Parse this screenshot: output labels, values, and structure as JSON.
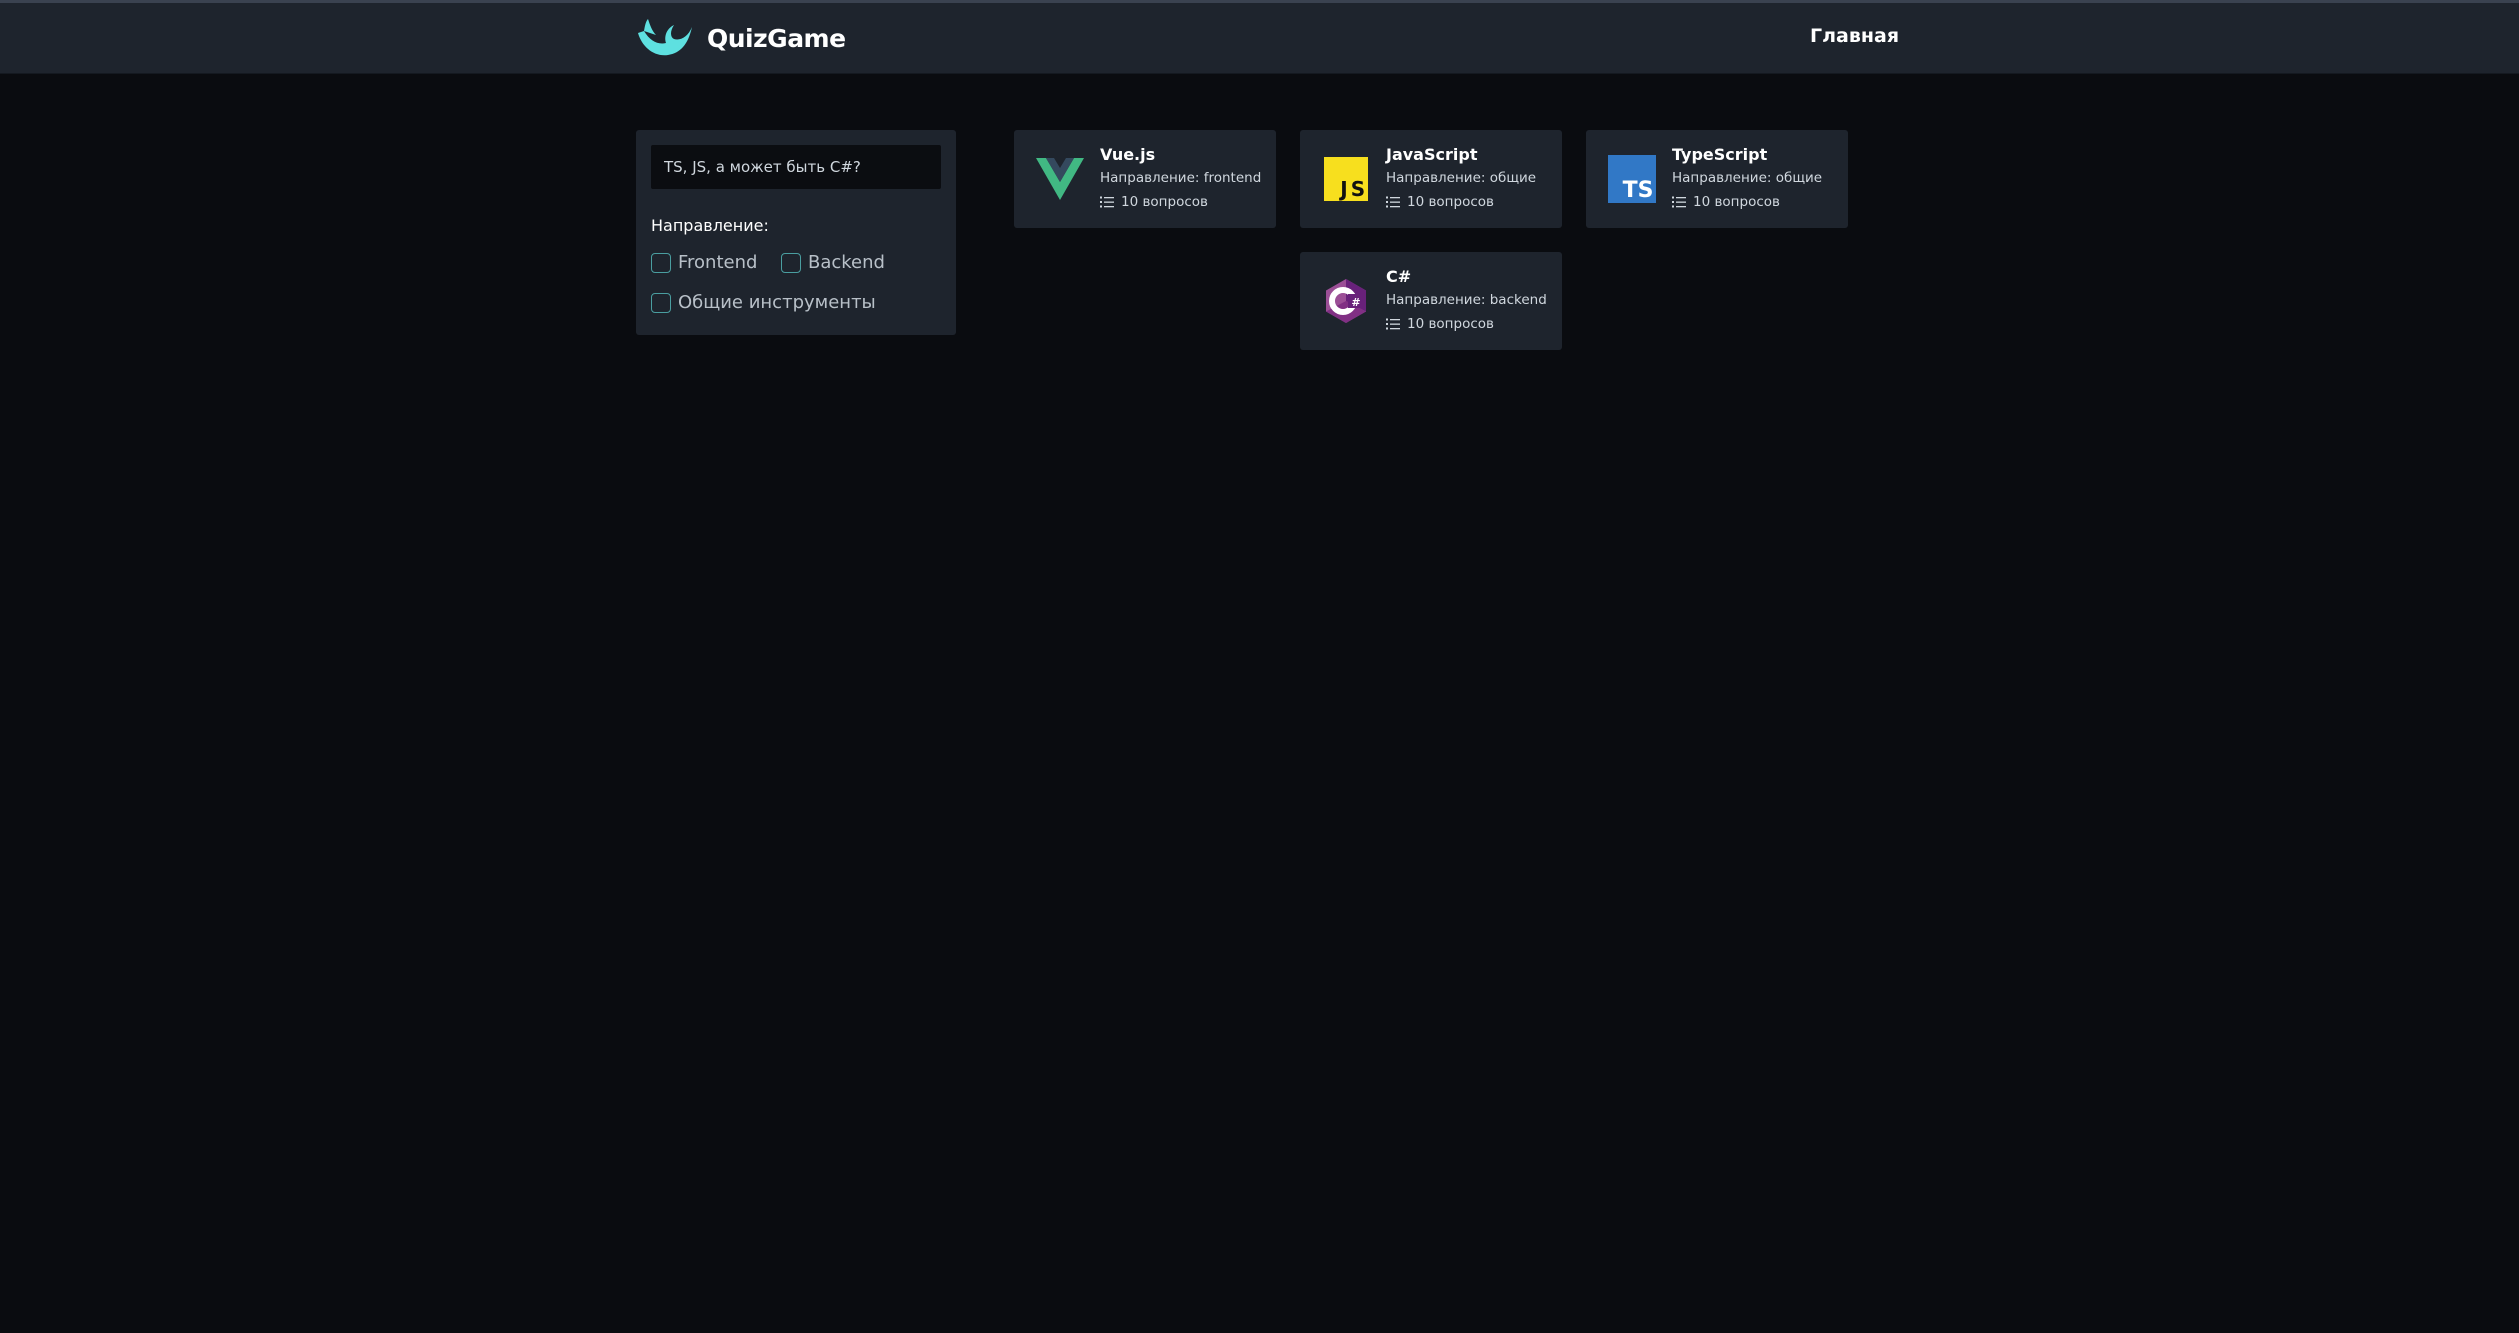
{
  "app": {
    "name": "QuizGame",
    "brand_color": "#5ee0e0"
  },
  "nav": {
    "home": "Главная"
  },
  "filter": {
    "search_placeholder": "TS, JS, а может быть C#?",
    "direction_label": "Направление:",
    "options": [
      {
        "label": "Frontend",
        "checked": false
      },
      {
        "label": "Backend",
        "checked": false
      },
      {
        "label": "Общие инструменты",
        "checked": false
      }
    ]
  },
  "quizzes": [
    {
      "title": "Vue.js",
      "direction": "Направление: frontend",
      "questions": "10 вопросов",
      "icon": "vue-logo-icon"
    },
    {
      "title": "JavaScript",
      "direction": "Направление: общие",
      "questions": "10 вопросов",
      "icon": "javascript-logo-icon"
    },
    {
      "title": "TypeScript",
      "direction": "Направление: общие",
      "questions": "10 вопросов",
      "icon": "typescript-logo-icon"
    },
    {
      "title": "C#",
      "direction": "Направление: backend",
      "questions": "10 вопросов",
      "icon": "csharp-logo-icon"
    }
  ],
  "colors": {
    "background": "#0a0c10",
    "panel": "#1e242d",
    "checkbox_border": "#4a9ea0",
    "vue_green": "#41b883",
    "vue_dark": "#34495e",
    "js_yellow": "#f7df1e",
    "ts_blue": "#3178c6",
    "csharp_purple": "#68217a"
  }
}
